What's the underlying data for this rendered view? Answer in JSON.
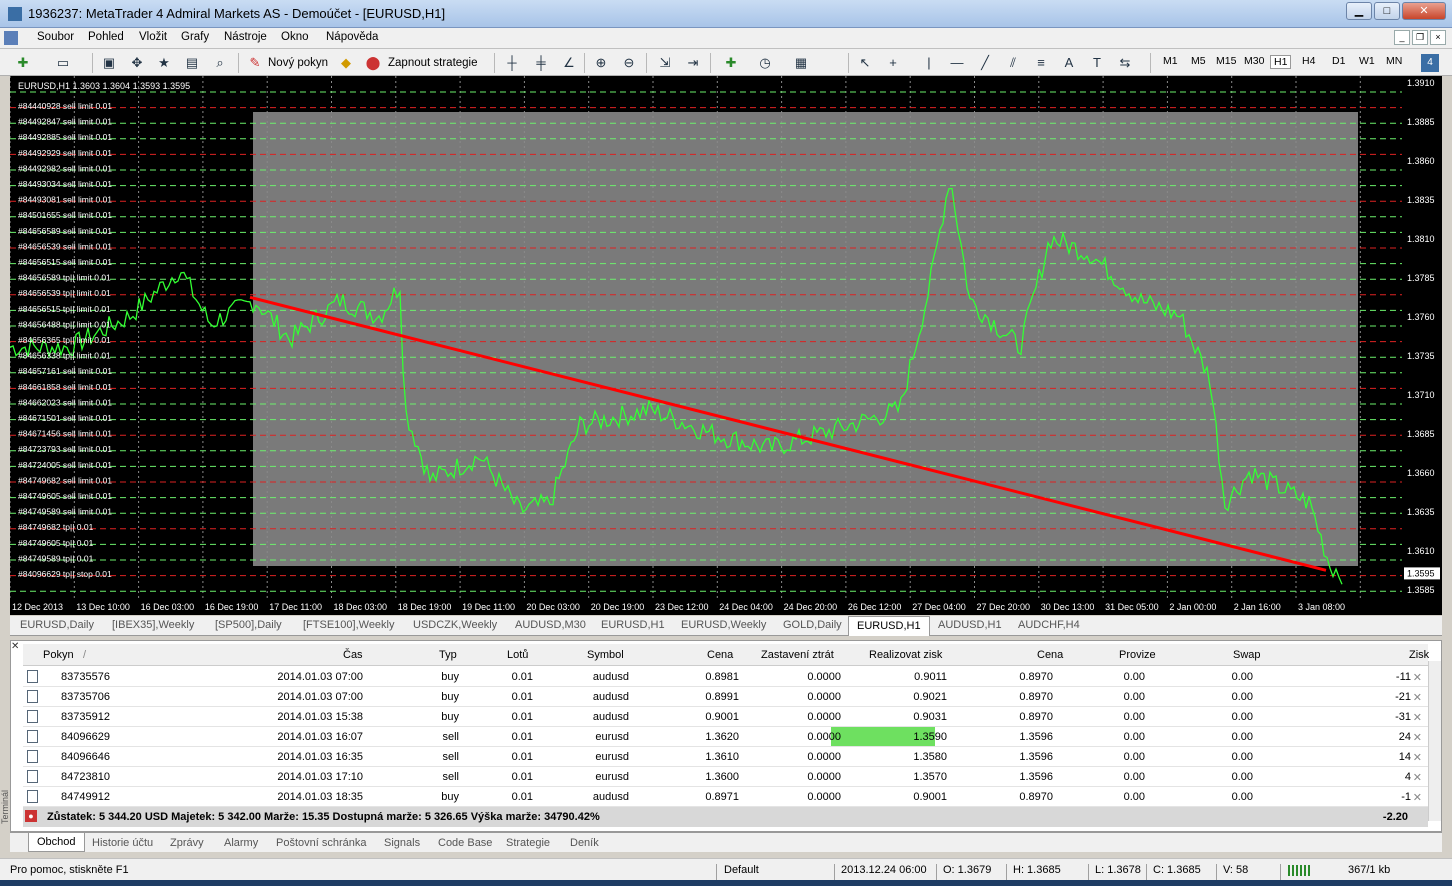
{
  "window": {
    "title": "1936237: MetaTrader 4 Admiral Markets AS - Demoúčet - [EURUSD,H1]",
    "min": "▁",
    "max": "□",
    "close": "✕"
  },
  "menu": [
    "Soubor",
    "Pohled",
    "Vložit",
    "Grafy",
    "Nástroje",
    "Okno",
    "Nápověda"
  ],
  "toolbar": {
    "new_order": "Nový pokyn",
    "autotrading": "Zapnout strategie",
    "timeframes": [
      "M1",
      "M5",
      "M15",
      "M30",
      "H1",
      "H4",
      "D1",
      "W1",
      "MN"
    ],
    "active_tf": "H1"
  },
  "chart": {
    "header": "EURUSD,H1  1.3603 1.3604 1.3593 1.3595",
    "price_labels": [
      "1.3910",
      "1.3885",
      "1.3860",
      "1.3835",
      "1.3810",
      "1.3785",
      "1.3760",
      "1.3735",
      "1.3710",
      "1.3685",
      "1.3660",
      "1.3635",
      "1.3610",
      "1.3585"
    ],
    "current_price": "1.3595",
    "time_labels": [
      "12 Dec 2013",
      "13 Dec 10:00",
      "16 Dec 03:00",
      "16 Dec 19:00",
      "17 Dec 11:00",
      "18 Dec 03:00",
      "18 Dec 19:00",
      "19 Dec 11:00",
      "20 Dec 03:00",
      "20 Dec 19:00",
      "23 Dec 12:00",
      "24 Dec 04:00",
      "24 Dec 20:00",
      "26 Dec 12:00",
      "27 Dec 04:00",
      "27 Dec 20:00",
      "30 Dec 13:00",
      "31 Dec 05:00",
      "2 Jan 00:00",
      "2 Jan 16:00",
      "3 Jan 08:00"
    ],
    "order_labels": [
      "#84440928 sell limit 0.01",
      "#84492847 sell limit 0.01",
      "#84492885 sell limit 0.01",
      "#84492929 sell limit 0.01",
      "#84492982 sell limit 0.01",
      "#84493034 sell limit 0.01",
      "#84493081 sell limit 0.01",
      "#84501655 sell limit 0.01",
      "#84656589 sell limit 0.01",
      "#84656539 sell limit 0.01",
      "#84656515 sell limit 0.01",
      "#84656589 tp|| limit 0.01",
      "#84656539 tp|| limit 0.01",
      "#84656515 tp|| limit 0.01",
      "#84656488 tp|| limit 0.01",
      "#84656365 tp|| limit 0.01",
      "#84656338 tp|| limit 0.01",
      "#84657161 sell limit 0.01",
      "#84661858 sell limit 0.01",
      "#84662023 sell limit 0.01",
      "#84671501 sell limit 0.01",
      "#84671456 sell limit 0.01",
      "#84723793 sell limit 0.01",
      "#84724005 sell limit 0.01",
      "#84749682 sell limit 0.01",
      "#84749605 sell limit 0.01",
      "#84749589 sell limit 0.01",
      "#84749682 tp|| 0.01",
      "#84749605 tp|| 0.01",
      "#84749589 tp|| 0.01",
      "#84096629 tp|| stop 0.01"
    ]
  },
  "chart_tabs": [
    "EURUSD,Daily",
    "[IBEX35],Weekly",
    "[SP500],Daily",
    "[FTSE100],Weekly",
    "USDCZK,Weekly",
    "AUDUSD,M30",
    "EURUSD,H1",
    "EURUSD,Weekly",
    "GOLD,Daily",
    "EURUSD,H1",
    "AUDUSD,H1",
    "AUDCHF,H4"
  ],
  "active_chart_tab": "EURUSD,H1",
  "terminal": {
    "headers": [
      "Pokyn",
      "/",
      "Čas",
      "Typ",
      "Lotů",
      "Symbol",
      "Cena",
      "Zastavení ztrát",
      "Realizovat zisk",
      "Cena",
      "Provize",
      "Swap",
      "Zisk"
    ],
    "rows": [
      [
        "83735576",
        "2014.01.03 07:00",
        "buy",
        "0.01",
        "audusd",
        "0.8981",
        "0.0000",
        "0.9011",
        "0.8970",
        "0.00",
        "0.00",
        "-11"
      ],
      [
        "83735706",
        "2014.01.03 07:00",
        "buy",
        "0.01",
        "audusd",
        "0.8991",
        "0.0000",
        "0.9021",
        "0.8970",
        "0.00",
        "0.00",
        "-21"
      ],
      [
        "83735912",
        "2014.01.03 15:38",
        "buy",
        "0.01",
        "audusd",
        "0.9001",
        "0.0000",
        "0.9031",
        "0.8970",
        "0.00",
        "0.00",
        "-31"
      ],
      [
        "84096629",
        "2014.01.03 16:07",
        "sell",
        "0.01",
        "eurusd",
        "1.3620",
        "0.0000",
        "1.3590",
        "1.3596",
        "0.00",
        "0.00",
        "24"
      ],
      [
        "84096646",
        "2014.01.03 16:35",
        "sell",
        "0.01",
        "eurusd",
        "1.3610",
        "0.0000",
        "1.3580",
        "1.3596",
        "0.00",
        "0.00",
        "14"
      ],
      [
        "84723810",
        "2014.01.03 17:10",
        "sell",
        "0.01",
        "eurusd",
        "1.3600",
        "0.0000",
        "1.3570",
        "1.3596",
        "0.00",
        "0.00",
        "4"
      ],
      [
        "84749912",
        "2014.01.03 18:35",
        "buy",
        "0.01",
        "audusd",
        "0.8971",
        "0.0000",
        "0.9001",
        "0.8970",
        "0.00",
        "0.00",
        "-1"
      ]
    ],
    "balance": "Zůstatek: 5 344.20 USD  Majetek: 5 342.00  Marže: 15.35  Dostupná marže: 5 326.65  Výška marže: 34790.42%",
    "total": "-2.20",
    "side_label": "Terminál",
    "tabs": [
      "Obchod",
      "Historie účtu",
      "Zprávy",
      "Alarmy",
      "Poštovní schránka",
      "Signals",
      "Code Base",
      "Strategie",
      "Deník"
    ]
  },
  "status": {
    "help": "Pro pomoc, stiskněte F1",
    "profile": "Default",
    "time": "2013.12.24 06:00",
    "open": "O: 1.3679",
    "high": "H: 1.3685",
    "low": "L: 1.3678",
    "close": "C: 1.3685",
    "volume": "V: 58",
    "traffic": "367/1 kb"
  }
}
